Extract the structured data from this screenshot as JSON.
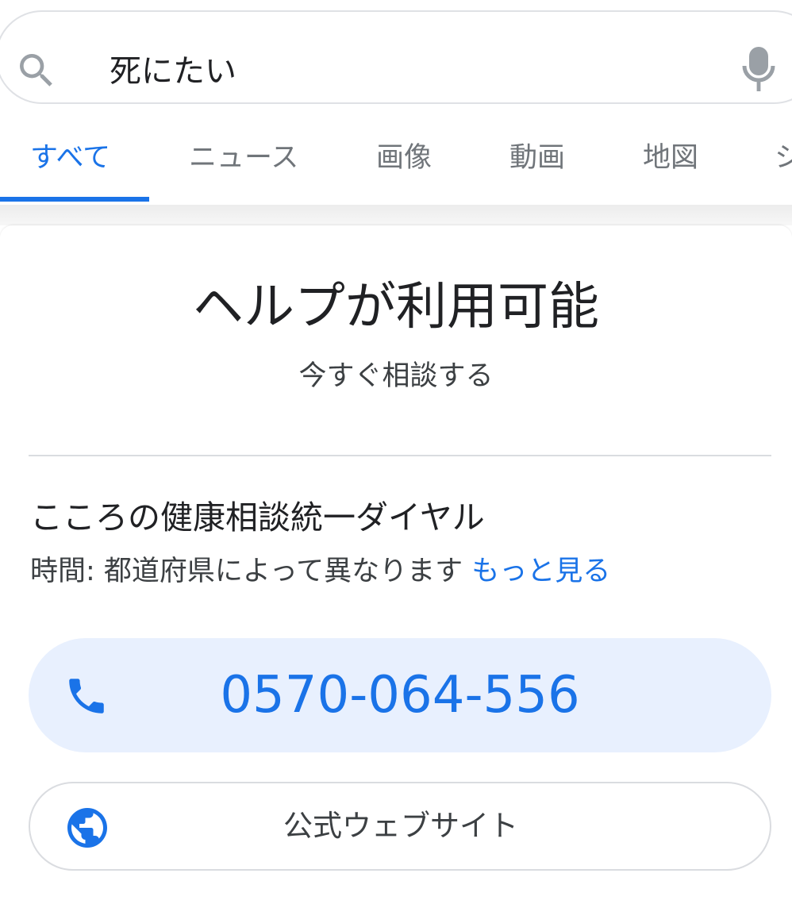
{
  "search": {
    "query": "死にたい"
  },
  "tabs": [
    {
      "label": "すべて",
      "active": true
    },
    {
      "label": "ニュース",
      "active": false
    },
    {
      "label": "画像",
      "active": false
    },
    {
      "label": "動画",
      "active": false
    },
    {
      "label": "地図",
      "active": false
    },
    {
      "label": "シ",
      "active": false
    }
  ],
  "help_card": {
    "title": "ヘルプが利用可能",
    "subtitle": "今すぐ相談する",
    "org_name": "こころの健康相談統一ダイヤル",
    "hours_text": "時間: 都道府県によって異なります",
    "more_link": "もっと見る",
    "phone_number": "0570-064-556",
    "website_label": "公式ウェブサイト"
  },
  "colors": {
    "accent": "#1a73e8",
    "phone_button_bg": "#e8f0fe",
    "text_primary": "#202124",
    "text_secondary": "#70757a",
    "border": "#dfe1e5"
  },
  "icons": {
    "search": "search-icon",
    "mic": "mic-icon",
    "phone": "phone-icon",
    "globe": "globe-icon"
  }
}
